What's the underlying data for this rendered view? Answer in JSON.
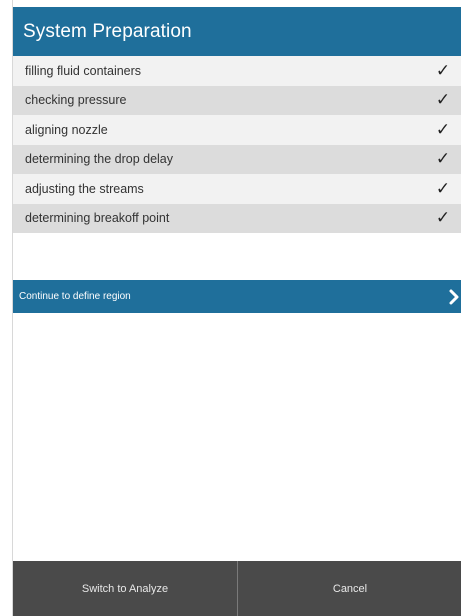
{
  "header": {
    "title": "System Preparation"
  },
  "steps": [
    {
      "label": "filling fluid containers",
      "status": "✓"
    },
    {
      "label": "checking pressure",
      "status": "✓"
    },
    {
      "label": "aligning nozzle",
      "status": "✓"
    },
    {
      "label": "determining the drop delay",
      "status": "✓"
    },
    {
      "label": "adjusting the streams",
      "status": "✓"
    },
    {
      "label": "determining breakoff point",
      "status": "✓"
    }
  ],
  "continue_bar": {
    "label": "Continue to define region",
    "icon": "chevron-right-icon"
  },
  "footer": {
    "switch_label": "Switch to Analyze",
    "cancel_label": "Cancel"
  },
  "colors": {
    "accent": "#1f6f9b",
    "footer_bg": "#4a4a4a"
  }
}
